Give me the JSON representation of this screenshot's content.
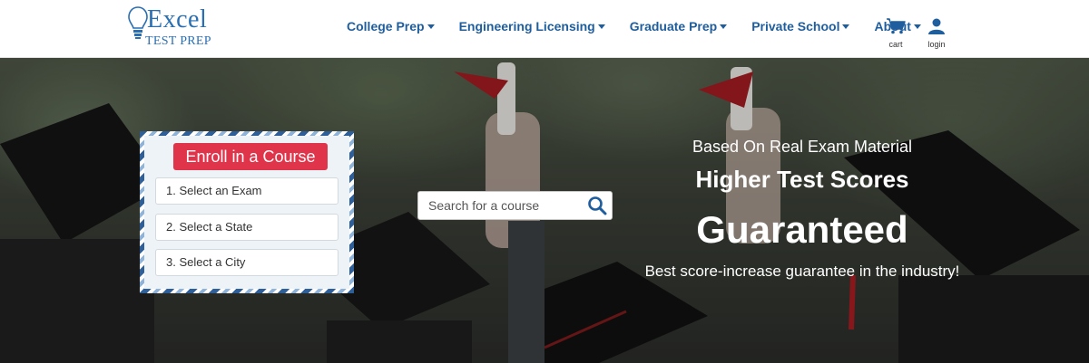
{
  "logo": {
    "line1": "Excel",
    "line2": "TEST PREP"
  },
  "nav": {
    "items": [
      {
        "label": "College Prep"
      },
      {
        "label": "Engineering Licensing"
      },
      {
        "label": "Graduate Prep"
      },
      {
        "label": "Private School"
      },
      {
        "label": "About"
      }
    ],
    "cart_label": "cart",
    "login_label": "login"
  },
  "enroll": {
    "title": "Enroll in a Course",
    "steps": [
      "1. Select an Exam",
      "2. Select a State",
      "3. Select a City"
    ]
  },
  "search": {
    "placeholder": "Search for a course"
  },
  "hero": {
    "subtitle": "Based On Real Exam Material",
    "headline": "Higher Test Scores",
    "big": "Guaranteed",
    "tagline": "Best score-increase guarantee in the industry!"
  },
  "colors": {
    "brand_blue": "#1f5e9e",
    "enroll_red": "#e0344a"
  }
}
